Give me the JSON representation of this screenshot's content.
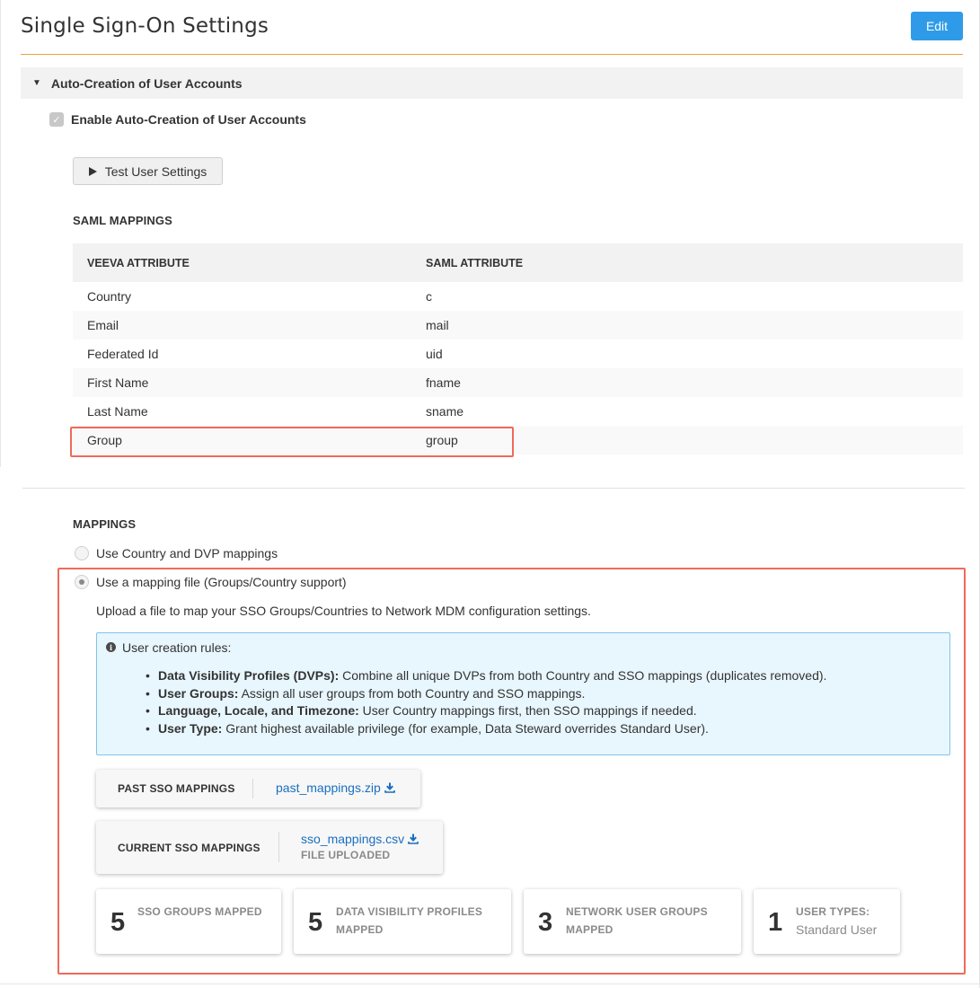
{
  "header": {
    "title": "Single Sign-On Settings",
    "edit_label": "Edit"
  },
  "auto_creation": {
    "section_title": "Auto-Creation of User Accounts",
    "checkbox_label": "Enable Auto-Creation of User Accounts",
    "checkbox_checked": true,
    "test_button_label": "Test User Settings"
  },
  "saml_mappings": {
    "heading": "SAML MAPPINGS",
    "columns": [
      "VEEVA ATTRIBUTE",
      "SAML ATTRIBUTE"
    ],
    "rows": [
      [
        "Country",
        "c"
      ],
      [
        "Email",
        "mail"
      ],
      [
        "Federated Id",
        "uid"
      ],
      [
        "First Name",
        "fname"
      ],
      [
        "Last Name",
        "sname"
      ],
      [
        "Group",
        "group"
      ]
    ]
  },
  "mappings": {
    "heading": "MAPPINGS",
    "option_country": "Use Country and DVP mappings",
    "option_file": "Use a mapping file (Groups/Country support)",
    "selected": "file",
    "upload_description": "Upload a file to map your SSO Groups/Countries to Network MDM configuration settings.",
    "rules_title": "User creation rules:",
    "rules": [
      {
        "term": "Data Visibility Profiles (DVPs):",
        "text": " Combine all unique DVPs from both Country and SSO mappings (duplicates removed)."
      },
      {
        "term": "User Groups:",
        "text": " Assign all user groups from both Country and SSO mappings."
      },
      {
        "term": "Language, Locale, and Timezone:",
        "text": " User Country mappings first, then SSO mappings if needed."
      },
      {
        "term": "User Type:",
        "text": " Grant highest available privilege (for example, Data Steward overrides Standard User)."
      }
    ],
    "past": {
      "label": "PAST SSO MAPPINGS",
      "file": "past_mappings.zip"
    },
    "current": {
      "label": "CURRENT SSO MAPPINGS",
      "file": "sso_mappings.csv",
      "status": "FILE UPLOADED"
    },
    "stats": [
      {
        "count": "5",
        "label_line1": "SSO GROUPS MAPPED",
        "label_line2": ""
      },
      {
        "count": "5",
        "label_line1": "DATA VISIBILITY PROFILES",
        "label_line2": "MAPPED"
      },
      {
        "count": "3",
        "label_line1": "NETWORK USER GROUPS",
        "label_line2": "MAPPED"
      },
      {
        "count": "1",
        "label_line1": "USER TYPES:",
        "label_line2": "Standard User"
      }
    ]
  },
  "colors": {
    "accent_blue": "#2f9be8",
    "header_underline": "#e8a43a",
    "highlight_red": "#ef6a5a",
    "link_blue": "#1a6fbf",
    "info_bg": "#e8f6fd",
    "info_border": "#7fc6e8"
  }
}
